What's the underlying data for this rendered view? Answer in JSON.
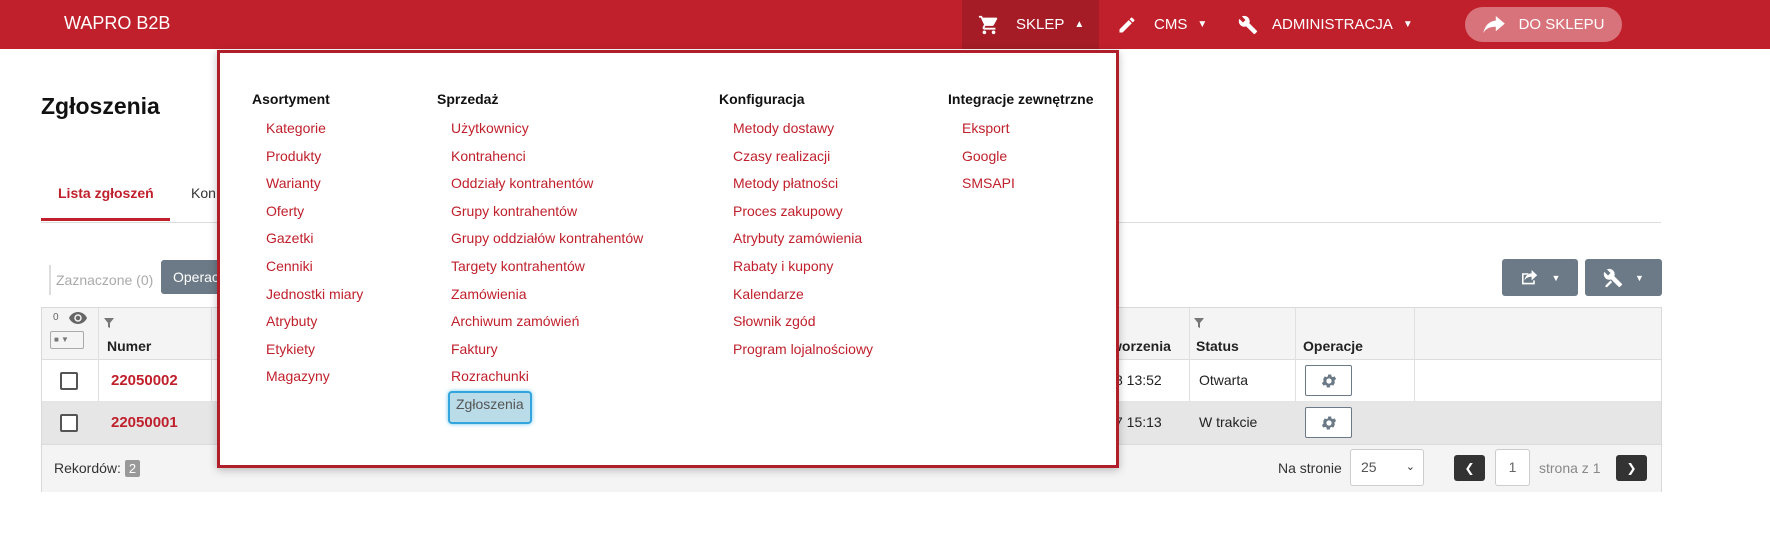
{
  "brand": "WAPRO B2B",
  "nav": {
    "sklep": "SKLEP",
    "cms": "CMS",
    "admin": "ADMINISTRACJA",
    "shop_button": "DO SKLEPU"
  },
  "page": {
    "title": "Zgłoszenia",
    "tabs": [
      "Lista zgłoszeń",
      "Kon"
    ]
  },
  "toolbar": {
    "selected": "Zaznaczone (0)",
    "operations": "Operac"
  },
  "table": {
    "header_count": "0",
    "columns": {
      "numer": "Numer",
      "date_partial": "worzenia",
      "status": "Status",
      "operacje": "Operacje"
    },
    "rows": [
      {
        "numer": "22050002",
        "date": "8 13:52",
        "status": "Otwarta"
      },
      {
        "numer": "22050001",
        "date": "7 15:13",
        "status": "W trakcie"
      }
    ],
    "footer": {
      "records_label": "Rekordów:",
      "records_count": "2",
      "per_page_label": "Na stronie",
      "per_page_value": "25",
      "page": "1",
      "page_of": "strona z 1"
    }
  },
  "menu": {
    "asortyment": {
      "title": "Asortyment",
      "items": [
        "Kategorie",
        "Produkty",
        "Warianty",
        "Oferty",
        "Gazetki",
        "Cenniki",
        "Jednostki miary",
        "Atrybuty",
        "Etykiety",
        "Magazyny"
      ]
    },
    "sprzedaz": {
      "title": "Sprzedaż",
      "items": [
        "Użytkownicy",
        "Kontrahenci",
        "Oddziały kontrahentów",
        "Grupy kontrahentów",
        "Grupy oddziałów kontrahentów",
        "Targety kontrahentów",
        "Zamówienia",
        "Archiwum zamówień",
        "Faktury",
        "Rozrachunki",
        "Zgłoszenia"
      ]
    },
    "konfiguracja": {
      "title": "Konfiguracja",
      "items": [
        "Metody dostawy",
        "Czasy realizacji",
        "Metody płatności",
        "Proces zakupowy",
        "Atrybuty zamówienia",
        "Rabaty i kupony",
        "Kalendarze",
        "Słownik zgód",
        "Program lojalnościowy"
      ]
    },
    "integracje": {
      "title": "Integracje zewnętrzne",
      "items": [
        "Eksport",
        "Google",
        "SMSAPI"
      ]
    }
  },
  "colors": {
    "brand": "#c0202c",
    "slate": "#6c7a87",
    "highlight": "#33a4dc"
  }
}
